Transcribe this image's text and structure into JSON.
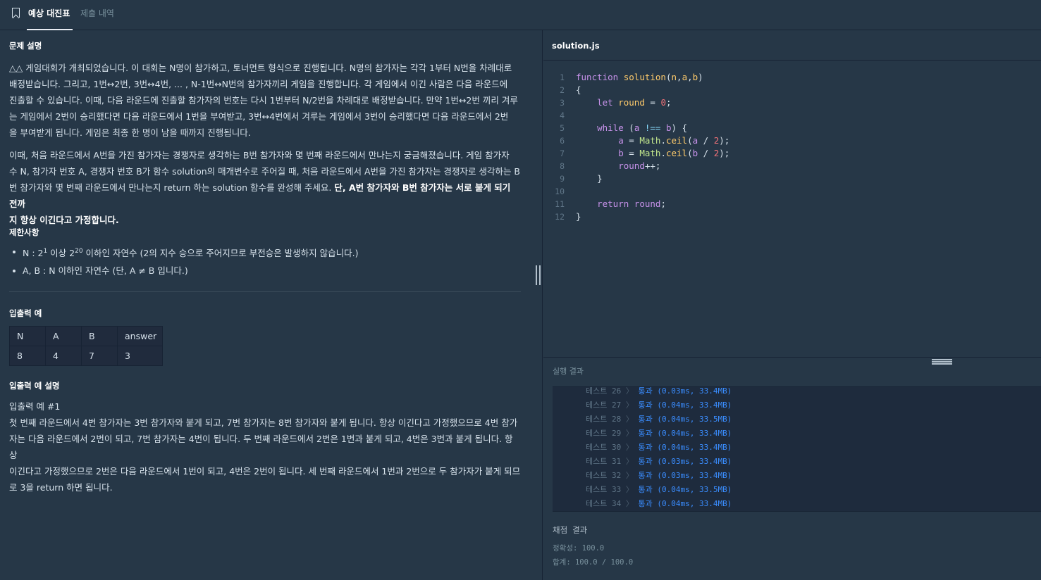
{
  "tabs": {
    "active": "예상 대진표",
    "inactive": "제출 내역"
  },
  "problem": {
    "section_title": "문제 설명",
    "para1_lines": [
      "△△ 게임대회가 개최되었습니다. 이 대회는 N명이 참가하고, 토너먼트 형식으로 진행됩니다. N명의 참가자는 각각 1부터 N번을 차례대로",
      "배정받습니다. 그리고, 1번↔2번, 3번↔4번, ... , N-1번↔N번의 참가자끼리 게임을 진행합니다. 각 게임에서 이긴 사람은 다음 라운드에",
      "진출할 수 있습니다. 이때, 다음 라운드에 진출할 참가자의 번호는 다시 1번부터 N/2번을 차례대로 배정받습니다. 만약 1번↔2번 끼리 겨루",
      "는 게임에서 2번이 승리했다면 다음 라운드에서 1번을 부여받고, 3번↔4번에서 겨루는 게임에서 3번이 승리했다면 다음 라운드에서 2번",
      "을 부여받게 됩니다. 게임은 최종 한 명이 남을 때까지 진행됩니다."
    ],
    "para2_lines": [
      "이때, 처음 라운드에서 A번을 가진 참가자는 경쟁자로 생각하는 B번 참가자와 몇 번째 라운드에서 만나는지 궁금해졌습니다. 게임 참가자",
      "수 N, 참가자 번호 A, 경쟁자 번호 B가 함수 solution의 매개변수로 주어질 때, 처음 라운드에서 A번을 가진 참가자는 경쟁자로 생각하는 B",
      "번 참가자와 몇 번째 라운드에서 만나는지 return 하는 solution 함수를 완성해 주세요."
    ],
    "para2_bold_1": "단, A번 참가자와 B번 참가자는 서로 붙게 되기 전까",
    "para2_bold_2": "지 항상 이긴다고 가정합니다.",
    "constraints_title": "제한사항",
    "constraint1_pre": "N : 2",
    "constraint1_sup1": "1",
    "constraint1_mid": " 이상 2",
    "constraint1_sup2": "20",
    "constraint1_post": " 이하인 자연수 (2의 지수 승으로 주어지므로 부전승은 발생하지 않습니다.)",
    "constraint2": "A, B : N 이하인 자연수 (단, A ≠ B 입니다.)",
    "io_title": "입출력 예",
    "io_headers": [
      "N",
      "A",
      "B",
      "answer"
    ],
    "io_row": [
      "8",
      "4",
      "7",
      "3"
    ],
    "io_explain_title": "입출력 예 설명",
    "io_example_label": "입출력 예 #1",
    "io_explain_lines": [
      "첫 번째 라운드에서 4번 참가자는 3번 참가자와 붙게 되고, 7번 참가자는 8번 참가자와 붙게 됩니다. 항상 이긴다고 가정했으므로 4번 참가",
      "자는 다음 라운드에서 2번이 되고, 7번 참가자는 4번이 됩니다. 두 번째 라운드에서 2번은 1번과 붙게 되고, 4번은 3번과 붙게 됩니다. 항상",
      "이긴다고 가정했으므로 2번은 다음 라운드에서 1번이 되고, 4번은 2번이 됩니다. 세 번째 라운드에서 1번과 2번으로 두 참가자가 붙게 되므",
      "로 3을 return 하면 됩니다."
    ]
  },
  "editor": {
    "filename": "solution.js",
    "line_numbers": [
      "1",
      "2",
      "3",
      "4",
      "5",
      "6",
      "7",
      "8",
      "9",
      "10",
      "11",
      "12"
    ]
  },
  "results": {
    "title": "실행 결과",
    "tests": [
      {
        "name": "테스트 26",
        "sep": "〉",
        "status": "통과 (0.03ms, 33.4MB)"
      },
      {
        "name": "테스트 27",
        "sep": "〉",
        "status": "통과 (0.04ms, 33.4MB)"
      },
      {
        "name": "테스트 28",
        "sep": "〉",
        "status": "통과 (0.04ms, 33.5MB)"
      },
      {
        "name": "테스트 29",
        "sep": "〉",
        "status": "통과 (0.04ms, 33.4MB)"
      },
      {
        "name": "테스트 30",
        "sep": "〉",
        "status": "통과 (0.04ms, 33.4MB)"
      },
      {
        "name": "테스트 31",
        "sep": "〉",
        "status": "통과 (0.03ms, 33.4MB)"
      },
      {
        "name": "테스트 32",
        "sep": "〉",
        "status": "통과 (0.03ms, 33.4MB)"
      },
      {
        "name": "테스트 33",
        "sep": "〉",
        "status": "통과 (0.04ms, 33.5MB)"
      },
      {
        "name": "테스트 34",
        "sep": "〉",
        "status": "통과 (0.04ms, 33.4MB)"
      }
    ],
    "score_title": "채점 결과",
    "accuracy": "정확성: 100.0",
    "total": "합계: 100.0 / 100.0"
  }
}
